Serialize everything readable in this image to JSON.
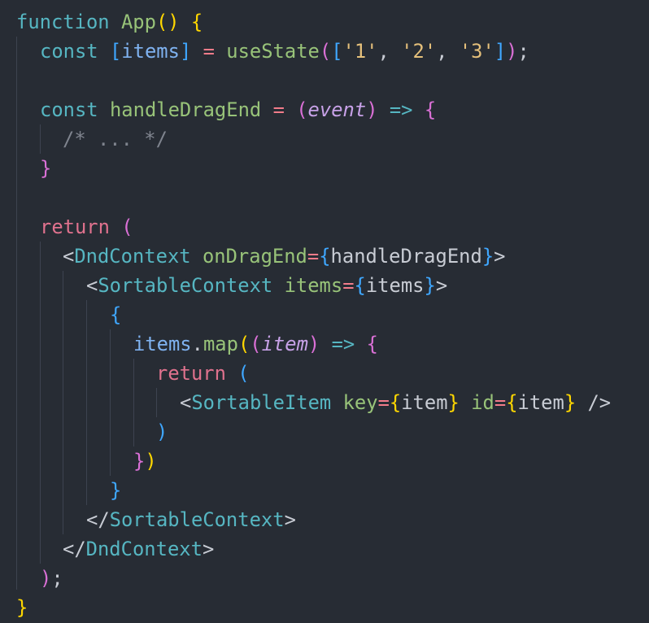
{
  "code": {
    "fn_keyword": "function",
    "fn_name": "App",
    "const_keyword": "const",
    "state_var": "items",
    "use_state": "useState",
    "state_values": [
      "'1'",
      "'2'",
      "'3'"
    ],
    "handler_name": "handleDragEnd",
    "event_param": "event",
    "arrow": "=>",
    "comment": "/* ... */",
    "return_keyword": "return",
    "dnd_context_tag": "DndContext",
    "on_drag_end_attr": "onDragEnd",
    "sortable_context_tag": "SortableContext",
    "items_attr": "items",
    "map_object": "items",
    "map_method": "map",
    "item_param": "item",
    "sortable_item_tag": "SortableItem",
    "key_attr": "key",
    "id_attr": "id",
    "item_value": "item"
  },
  "colors": {
    "background": "#272c34",
    "keyword": "#56b6c2",
    "return_keyword": "#e0728e",
    "function_name": "#98c379",
    "identifier": "#7fb2f0",
    "string": "#e5c07b",
    "comment": "#7f848e",
    "bracket_gold": "#ffd700",
    "bracket_orchid": "#da70d6",
    "bracket_blue": "#3fa7ff"
  }
}
